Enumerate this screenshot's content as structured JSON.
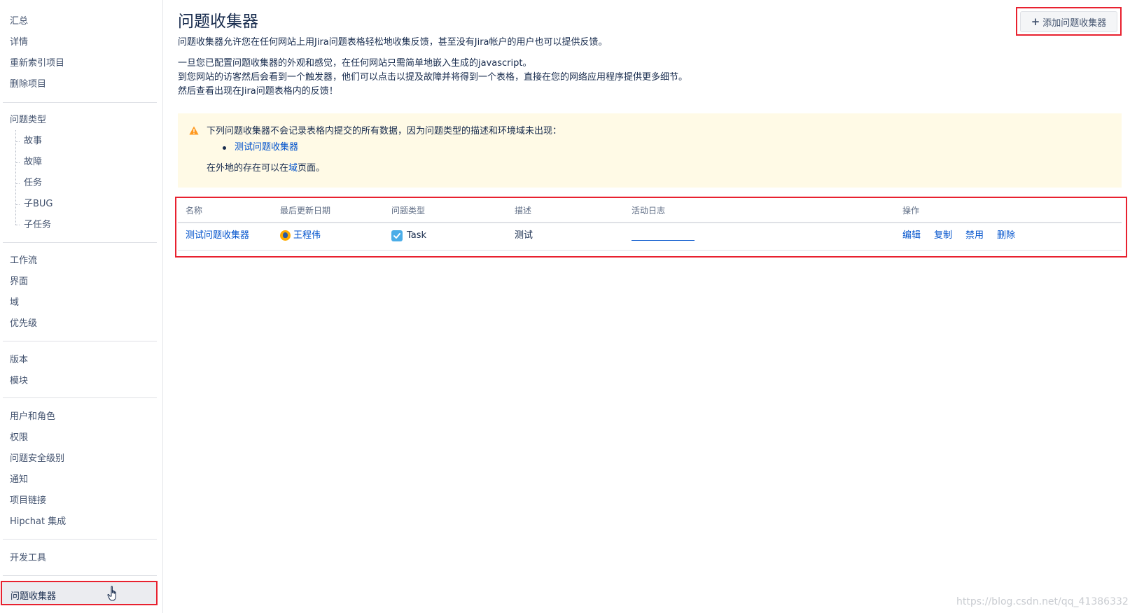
{
  "sidebar": {
    "group1": [
      "汇总",
      "详情",
      "重新索引项目",
      "删除项目"
    ],
    "issue_types": {
      "label": "问题类型",
      "items": [
        "故事",
        "故障",
        "任务",
        "子BUG",
        "子任务"
      ]
    },
    "group3": [
      "工作流",
      "界面",
      "域",
      "优先级"
    ],
    "group4": [
      "版本",
      "模块"
    ],
    "group5": [
      "用户和角色",
      "权限",
      "问题安全级别",
      "通知",
      "项目链接",
      "Hipchat 集成"
    ],
    "group6": [
      "开发工具"
    ],
    "active": "问题收集器"
  },
  "main": {
    "title": "问题收集器",
    "add_button": "添加问题收集器",
    "intro": [
      "问题收集器允许您在任何网站上用Jira问题表格轻松地收集反馈，甚至没有Jira帐户的用户也可以提供反馈。",
      "一旦您已配置问题收集器的外观和感觉，在任何网站只需简单地嵌入生成的javascript。",
      "到您网站的访客然后会看到一个触发器，他们可以点击以提及故障并将得到一个表格，直接在您的网络应用程序提供更多细节。",
      "然后查看出现在Jira问题表格内的反馈！"
    ],
    "warning": {
      "text": "下列问题收集器不会记录表格内提交的所有数据，因为问题类型的描述和环境域未出现：",
      "collector_link": "测试问题收集器",
      "footer_prefix": "在外地的存在可以在",
      "footer_link": "域",
      "footer_suffix": "页面。"
    },
    "table": {
      "headers": [
        "名称",
        "最后更新日期",
        "问题类型",
        "描述",
        "活动日志",
        "操作"
      ],
      "row": {
        "name": "测试问题收集器",
        "updated_by": "王程伟",
        "issue_type": "Task",
        "description": "测试",
        "actions": [
          "编辑",
          "复制",
          "禁用",
          "删除"
        ]
      }
    }
  },
  "watermark": "https://blog.csdn.net/qq_41386332",
  "colors": {
    "link": "#0052cc",
    "highlight_frame": "#e8212f",
    "warning_bg": "#fffae6",
    "warning_icon": "#ff991f"
  }
}
